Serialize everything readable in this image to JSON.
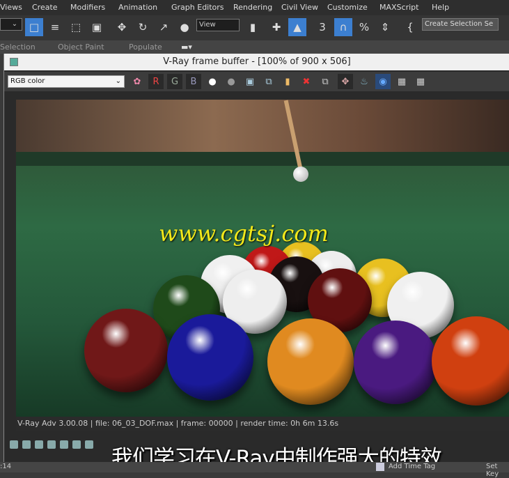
{
  "menu": [
    "Views",
    "Create",
    "Modifiers",
    "Animation",
    "Graph Editors",
    "Rendering",
    "Civil View",
    "Customize",
    "MAXScript",
    "Help"
  ],
  "toolbar": {
    "view_dropdown": "View",
    "selection_set": "Create Selection Se",
    "snap_angle": "3"
  },
  "ribbon": [
    "Selection",
    "Object Paint",
    "Populate"
  ],
  "vfb": {
    "title": "V-Ray frame buffer - [100% of 900 x 506]",
    "channel": "RGB color",
    "r": "R",
    "g": "G",
    "b": "B",
    "status": "V-Ray Adv 3.00.08 | file: 06_03_DOF.max | frame: 00000 |  render time:  0h  6m 13.6s"
  },
  "watermark": "www.cgtsj.com",
  "subtitle": "我们学习在V-Ray中制作强大的特效",
  "bottom": {
    "time": ":14",
    "add_time_tag": "Add Time Tag",
    "set_key": "Set Key"
  },
  "colors": {
    "accent": "#3c7fd0",
    "watermark": "#f2e81a"
  }
}
